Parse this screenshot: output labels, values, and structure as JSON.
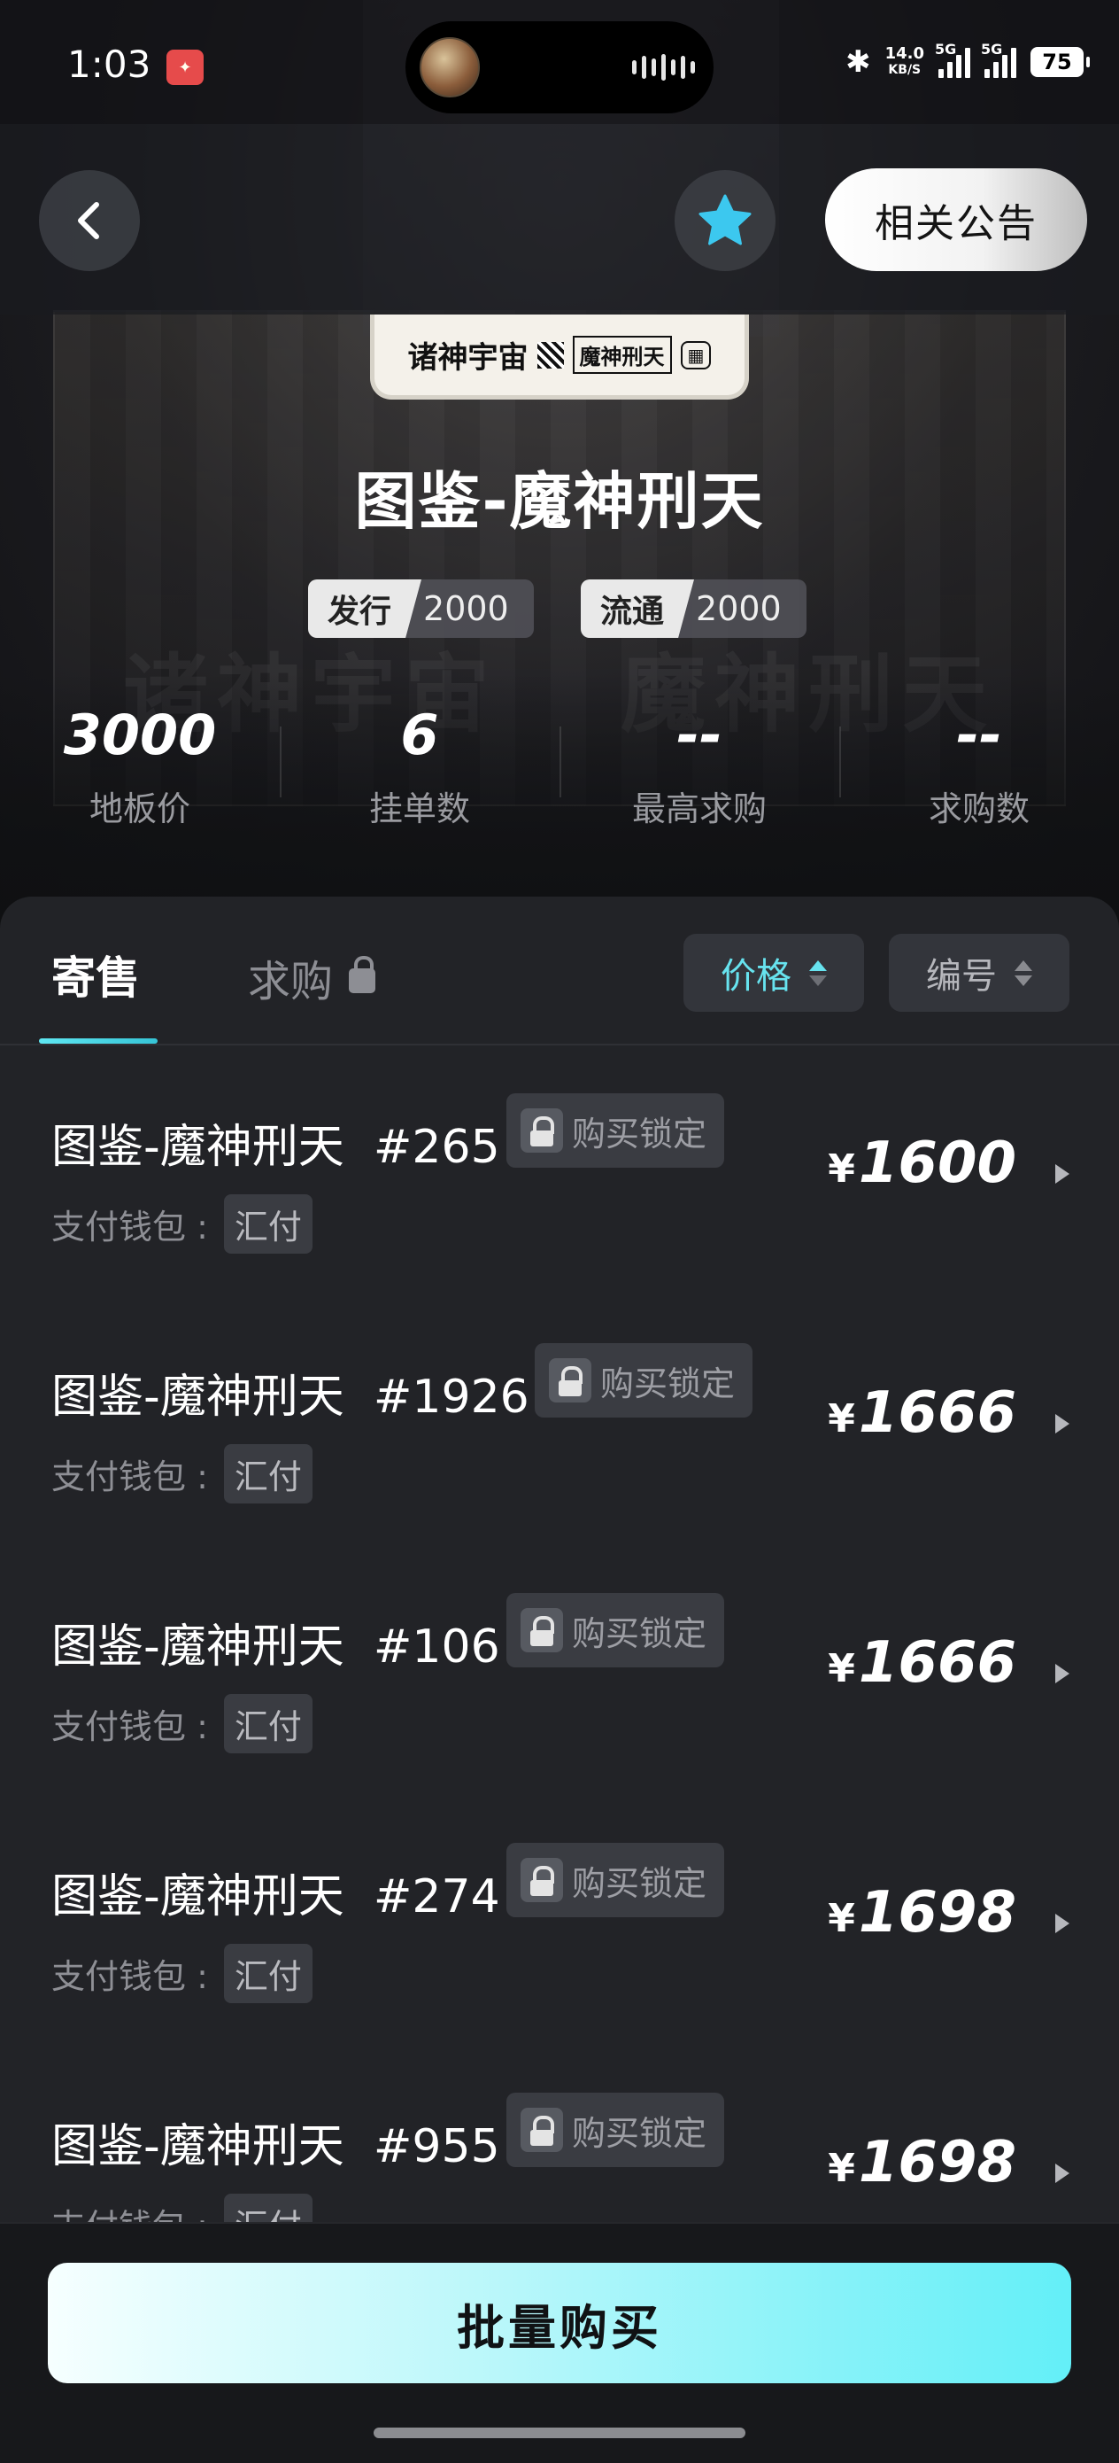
{
  "status_bar": {
    "time": "1:03",
    "network_speed_value": "14.0",
    "network_speed_unit": "KB/S",
    "sim1_label": "5G",
    "sim2_label": "5G",
    "battery": "75"
  },
  "nav": {
    "notice_label": "相关公告",
    "favorite_color": "#3cc8ef"
  },
  "card_thumb": {
    "text_left": "诸神宇宙",
    "text_mid": "魔神刑天"
  },
  "hero": {
    "background_text": [
      "诸神宇宙",
      "魔神刑天"
    ],
    "title": "图鉴-魔神刑天",
    "issue_label": "发行",
    "issue_value": "2000",
    "circulation_label": "流通",
    "circulation_value": "2000"
  },
  "stats": [
    {
      "value": "3000",
      "label": "地板价"
    },
    {
      "value": "6",
      "label": "挂单数"
    },
    {
      "value": "--",
      "label": "最高求购"
    },
    {
      "value": "--",
      "label": "求购数"
    }
  ],
  "tabs": {
    "sell": "寄售",
    "buy": "求购"
  },
  "sort": {
    "price": "价格",
    "number": "编号"
  },
  "listings": [
    {
      "name": "图鉴-魔神刑天",
      "serial": "#265",
      "lock_label": "购买锁定",
      "wallet_label": "支付钱包 :",
      "wallet": "汇付",
      "currency": "¥",
      "price": "1600"
    },
    {
      "name": "图鉴-魔神刑天",
      "serial": "#1926",
      "lock_label": "购买锁定",
      "wallet_label": "支付钱包 :",
      "wallet": "汇付",
      "currency": "¥",
      "price": "1666"
    },
    {
      "name": "图鉴-魔神刑天",
      "serial": "#106",
      "lock_label": "购买锁定",
      "wallet_label": "支付钱包 :",
      "wallet": "汇付",
      "currency": "¥",
      "price": "1666"
    },
    {
      "name": "图鉴-魔神刑天",
      "serial": "#274",
      "lock_label": "购买锁定",
      "wallet_label": "支付钱包 :",
      "wallet": "汇付",
      "currency": "¥",
      "price": "1698"
    },
    {
      "name": "图鉴-魔神刑天",
      "serial": "#955",
      "lock_label": "购买锁定",
      "wallet_label": "支付钱包 :",
      "wallet": "汇付",
      "currency": "¥",
      "price": "1698"
    }
  ],
  "bottom": {
    "bulk_buy": "批量购买"
  },
  "colors": {
    "accent": "#5fe7f2",
    "panel_bg": "#222327",
    "page_bg": "#0f1012"
  }
}
